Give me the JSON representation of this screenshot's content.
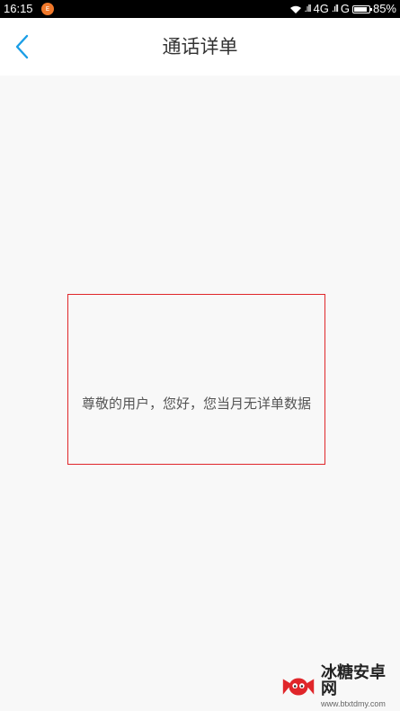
{
  "status_bar": {
    "time": "16:15",
    "notification_badge": "E",
    "network": "4G",
    "network2": "G",
    "battery_percent": "85%",
    "battery_level": 0.85
  },
  "header": {
    "title": "通话详单",
    "back_icon": "chevron-left-icon",
    "accent_color": "#1a9ee6"
  },
  "main": {
    "empty_message": "尊敬的用户，您好，您当月无详单数据",
    "highlight_color": "#e0262a"
  },
  "watermark": {
    "name": "冰糖安卓网",
    "url": "www.btxtdmy.com"
  }
}
